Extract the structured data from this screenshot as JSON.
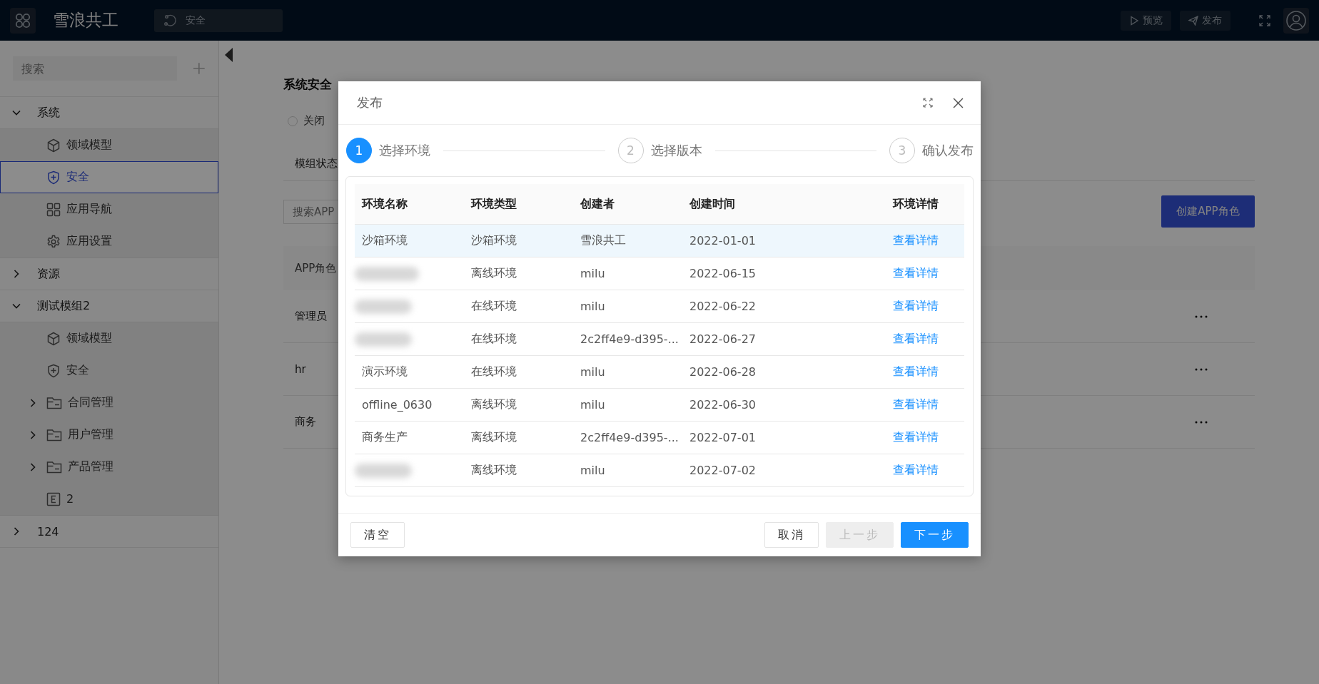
{
  "app": {
    "name": "雪浪共工",
    "breadcrumb": "安全",
    "actions": [
      {
        "label": "预览",
        "kind": "preview"
      },
      {
        "label": "发布",
        "kind": "publish"
      }
    ]
  },
  "sidebar": {
    "search_placeholder": "搜索",
    "items": [
      {
        "label": "系统",
        "selected": false,
        "expanded": true,
        "children": [
          {
            "label": "领域模型",
            "kind": "model",
            "selected": false
          },
          {
            "label": "安全",
            "kind": "security",
            "selected": true
          },
          {
            "label": "应用导航",
            "kind": "nav",
            "selected": false
          },
          {
            "label": "应用设置",
            "kind": "settings",
            "selected": false
          }
        ]
      },
      {
        "label": "资源",
        "selected": false,
        "expanded": false
      },
      {
        "label": "测试模组2",
        "selected": false,
        "expanded": true,
        "children": [
          {
            "label": "领域模型",
            "kind": "model",
            "selected": false
          },
          {
            "label": "安全",
            "kind": "security",
            "selected": false
          },
          {
            "label": "合同管理",
            "kind": "folder",
            "expanded": false,
            "selected": false
          },
          {
            "label": "用户管理",
            "kind": "folder",
            "expanded": false,
            "selected": false
          },
          {
            "label": "产品管理",
            "kind": "folder",
            "expanded": false,
            "selected": false
          },
          {
            "label": "2",
            "kind": "entity",
            "selected": false
          }
        ]
      },
      {
        "label": "124",
        "selected": false,
        "expanded": false
      }
    ]
  },
  "page": {
    "title": "系统安全",
    "radio": {
      "label": "关闭",
      "selected": false
    },
    "tab": "模组状态",
    "search_placeholder": "搜索APP",
    "create_button": "创建APP角色",
    "table": {
      "column_1": "APP角色",
      "rows": [
        {
          "name": "管理员"
        },
        {
          "name": "hr"
        },
        {
          "name": "商务"
        }
      ]
    }
  },
  "dialog": {
    "title": "发布",
    "steps": [
      {
        "number": "1",
        "label": "选择环境",
        "selected": true
      },
      {
        "number": "2",
        "label": "选择版本",
        "selected": false
      },
      {
        "number": "3",
        "label": "确认发布",
        "selected": false
      }
    ],
    "table": {
      "columns": [
        "环境名称",
        "环境类型",
        "创建者",
        "创建时间",
        "环境详情"
      ],
      "rows": [
        {
          "name": "沙箱环境",
          "type": "沙箱环境",
          "creator": "雪浪共工",
          "created": "2022-01-01",
          "link": "查看详情",
          "selected": true
        },
        {
          "redacted": true,
          "type": "离线环境",
          "creator": "milu",
          "created": "2022-06-15",
          "link": "查看详情",
          "selected": false
        },
        {
          "redacted": true,
          "type": "在线环境",
          "creator": "milu",
          "created": "2022-06-22",
          "link": "查看详情",
          "selected": false
        },
        {
          "redacted": true,
          "type": "在线环境",
          "creator": "2c2ff4e9-d395-...",
          "created": "2022-06-27",
          "link": "查看详情",
          "selected": false
        },
        {
          "name": "演示环境",
          "type": "在线环境",
          "creator": "milu",
          "created": "2022-06-28",
          "link": "查看详情",
          "selected": false
        },
        {
          "name": "offline_0630",
          "type": "离线环境",
          "creator": "milu",
          "created": "2022-06-30",
          "link": "查看详情",
          "selected": false
        },
        {
          "name": "商务生产",
          "type": "离线环境",
          "creator": "2c2ff4e9-d395-...",
          "created": "2022-07-01",
          "link": "查看详情",
          "selected": false
        },
        {
          "redacted": true,
          "type": "离线环境",
          "creator": "milu",
          "created": "2022-07-02",
          "link": "查看详情",
          "selected": false
        }
      ]
    },
    "buttons": [
      {
        "label": "清空",
        "kind": "clear",
        "disabled": false
      },
      {
        "label": "取消",
        "kind": "cancel",
        "disabled": false
      },
      {
        "label": "上一步",
        "kind": "prev",
        "disabled": true
      },
      {
        "label": "下一步",
        "kind": "next",
        "disabled": false
      }
    ]
  }
}
